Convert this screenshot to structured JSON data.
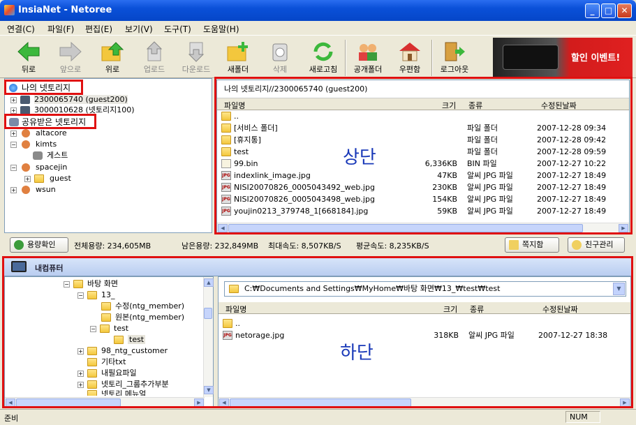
{
  "window": {
    "title": "InsiaNet - Netoree"
  },
  "menu": [
    "연결(C)",
    "파일(F)",
    "편집(E)",
    "보기(V)",
    "도구(T)",
    "도움말(H)"
  ],
  "toolbar": {
    "back": "뒤로",
    "forward": "앞으로",
    "up": "위로",
    "upload": "업로드",
    "download": "다운로드",
    "new_folder": "새폴더",
    "delete": "삭제",
    "refresh": "새로고침",
    "shared_folder": "공개폴더",
    "mailbox": "우편함",
    "logout": "로그아웃",
    "banner": "할인 이벤트!"
  },
  "upper_tree": {
    "my_netoree": "나의 넷토리지",
    "item1": "2300065740 (guest200)",
    "item2": "3000010628 (넷토리지100)",
    "shared": "공유받은 넷토리지",
    "shared_items": [
      "altacore",
      "kimts",
      "게스트",
      "spacejin",
      "guest",
      "wsun"
    ]
  },
  "upper_list": {
    "path": "나의 넷토리지//2300065740 (guest200)",
    "columns": {
      "name": "파일명",
      "size": "크기",
      "type": "종류",
      "modified": "수정된날짜"
    },
    "rows": [
      {
        "name": "..",
        "size": "",
        "type": "",
        "date": "",
        "icon": "folder-icon"
      },
      {
        "name": "[서비스 폴더]",
        "size": "",
        "type": "파일 폴더",
        "date": "2007-12-28 09:34",
        "icon": "folder-icon"
      },
      {
        "name": "[휴지통]",
        "size": "",
        "type": "파일 폴더",
        "date": "2007-12-28 09:42",
        "icon": "folder-icon"
      },
      {
        "name": "test",
        "size": "",
        "type": "파일 폴더",
        "date": "2007-12-28 09:59",
        "icon": "folder-icon"
      },
      {
        "name": "99.bin",
        "size": "6,336KB",
        "type": "BIN 파일",
        "date": "2007-12-27 10:22",
        "icon": "bin-file-icon"
      },
      {
        "name": "indexlink_image.jpg",
        "size": "47KB",
        "type": "알씨 JPG 파일",
        "date": "2007-12-27 18:49",
        "icon": "jpg-file-icon"
      },
      {
        "name": "NISI20070826_0005043492_web.jpg",
        "size": "230KB",
        "type": "알씨 JPG 파일",
        "date": "2007-12-27 18:49",
        "icon": "jpg-file-icon"
      },
      {
        "name": "NISI20070826_0005043498_web.jpg",
        "size": "154KB",
        "type": "알씨 JPG 파일",
        "date": "2007-12-27 18:49",
        "icon": "jpg-file-icon"
      },
      {
        "name": "youjin0213_379748_1[668184].jpg",
        "size": "59KB",
        "type": "알씨 JPG 파일",
        "date": "2007-12-27 18:49",
        "icon": "jpg-file-icon"
      }
    ],
    "overlay_label": "상단"
  },
  "status_strip": {
    "check_button": "용량확인",
    "total": "전체용량: 234,605MB",
    "remaining": "남은용량: 232,849MB",
    "max_speed": "최대속도: 8,507KB/S",
    "avg_speed": "평균속도: 8,235KB/S",
    "message_button": "쪽지함",
    "friends_button": "친구관리"
  },
  "lower": {
    "header": "내컴퓨터",
    "tree": [
      "바탕 화면",
      "13_",
      "수정(ntg_member)",
      "원본(ntg_member)",
      "test",
      "test",
      "98_ntg_customer",
      "기타txt",
      "내필요파일",
      "넷토리_그룹추가부분",
      "넷토리 메뉴얼"
    ],
    "path": "C:₩Documents and Settings₩MyHome₩바탕 화면₩13_₩test₩test",
    "rows": [
      {
        "name": "..",
        "size": "",
        "type": "",
        "date": "",
        "icon": "folder-icon"
      },
      {
        "name": "netorage.jpg",
        "size": "318KB",
        "type": "알씨 JPG 파일",
        "date": "2007-12-27 18:38",
        "icon": "jpg-file-icon"
      }
    ],
    "overlay_label": "하단"
  },
  "statusbar": {
    "left": "준비",
    "num": "NUM"
  }
}
